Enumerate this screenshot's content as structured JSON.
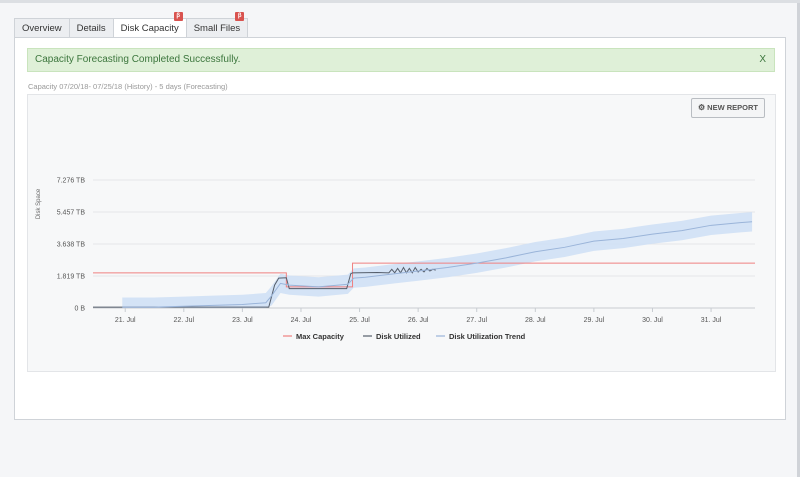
{
  "tabs": [
    {
      "label": "Overview",
      "badge": ""
    },
    {
      "label": "Details",
      "badge": ""
    },
    {
      "label": "Disk Capacity",
      "badge": "β",
      "active": true
    },
    {
      "label": "Small Files",
      "badge": "β"
    }
  ],
  "alert": {
    "message": "Capacity Forecasting Completed Successfully.",
    "close": "X"
  },
  "caption": "Capacity 07/20/18- 07/25/18 (History) - 5 days (Forecasting)",
  "new_report": {
    "icon": "gear-icon",
    "label": "NEW REPORT"
  },
  "colors": {
    "max": "#f08080",
    "utilized": "#555e6b",
    "trend": "#9ab4d9",
    "band": "#cfe0f5",
    "success_bg": "#dff0d8"
  },
  "chart_data": {
    "type": "line",
    "ylabel": "Disk Space",
    "y_ticks": [
      "0 B",
      "1.819 TB",
      "3.638 TB",
      "5.457 TB",
      "7.276 TB"
    ],
    "y_tick_values": [
      0,
      1.819,
      3.638,
      5.457,
      7.276
    ],
    "ylim": [
      0,
      7.276
    ],
    "x_ticks": [
      "21. Jul",
      "22. Jul",
      "23. Jul",
      "24. Jul",
      "25. Jul",
      "26. Jul",
      "27. Jul",
      "28. Jul",
      "29. Jul",
      "30. Jul",
      "31. Jul"
    ],
    "x_tick_values": [
      21,
      22,
      23,
      24,
      25,
      26,
      27,
      28,
      29,
      30,
      31
    ],
    "xlim": [
      20.45,
      31.75
    ],
    "legend": [
      "Max Capacity",
      "Disk Utilized",
      "Disk Utilization Trend"
    ],
    "legend_position": "bottom",
    "series": [
      {
        "name": "Max Capacity",
        "x": [
          20.45,
          23.75,
          23.75,
          24.88,
          24.88,
          31.75
        ],
        "y": [
          2.0,
          2.0,
          1.2,
          1.2,
          2.55,
          2.55
        ]
      },
      {
        "name": "Disk Utilized",
        "x": [
          20.45,
          23.45,
          23.55,
          23.62,
          23.75,
          23.8,
          24.78,
          24.85,
          24.88,
          25.3,
          25.5,
          25.55,
          25.6,
          25.65,
          25.7,
          25.75,
          25.8,
          25.85,
          25.9,
          25.95,
          26.0,
          26.05,
          26.1,
          26.15,
          26.2,
          26.25,
          26.3
        ],
        "y": [
          0.05,
          0.05,
          1.3,
          1.7,
          1.72,
          1.1,
          1.1,
          1.95,
          2.0,
          2.02,
          2.0,
          2.2,
          2.0,
          2.25,
          2.0,
          2.3,
          2.0,
          2.25,
          2.0,
          2.3,
          2.05,
          2.2,
          2.05,
          2.25,
          2.1,
          2.2,
          2.15
        ]
      },
      {
        "name": "Disk Utilization Trend",
        "x": [
          20.95,
          21.5,
          22.0,
          22.5,
          23.0,
          23.4,
          23.5,
          23.65,
          23.8,
          24.3,
          24.8,
          24.9,
          25.1,
          25.6,
          26.0,
          26.5,
          27.0,
          27.5,
          28.0,
          28.5,
          29.0,
          29.5,
          30.0,
          30.5,
          31.0,
          31.5,
          31.7
        ],
        "y": [
          0.05,
          0.05,
          0.1,
          0.15,
          0.2,
          0.3,
          0.7,
          1.4,
          1.3,
          1.2,
          1.35,
          1.7,
          1.75,
          1.95,
          2.1,
          2.3,
          2.55,
          2.85,
          3.2,
          3.45,
          3.8,
          3.95,
          4.2,
          4.4,
          4.7,
          4.85,
          4.9
        ]
      }
    ]
  }
}
